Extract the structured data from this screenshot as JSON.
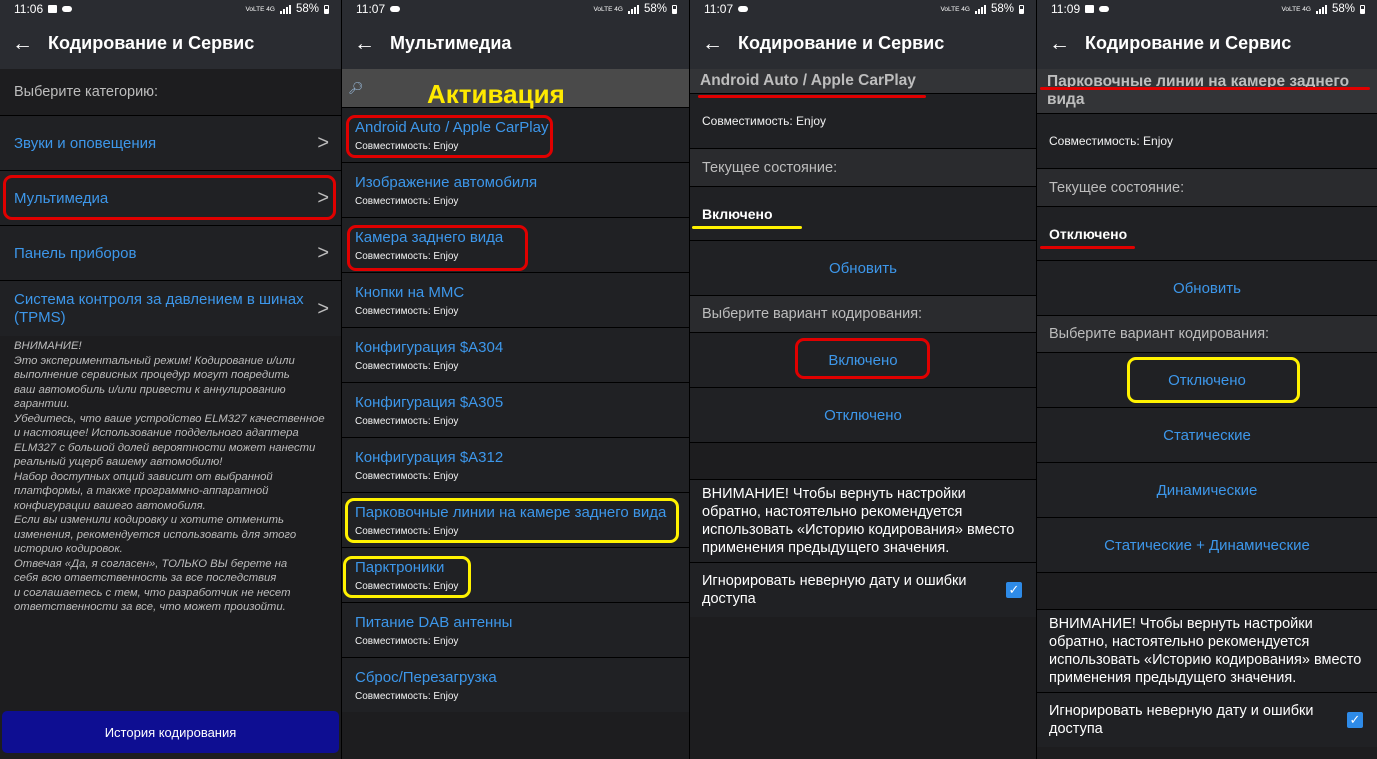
{
  "panel1": {
    "status": {
      "time": "11:06",
      "battery": "58%",
      "net": "VoLTE 4G"
    },
    "title": "Кодирование и Сервис",
    "prompt": "Выберите категорию:",
    "categories": [
      {
        "label": "Звуки и оповещения"
      },
      {
        "label": "Мультимедиа"
      },
      {
        "label": "Панель приборов"
      },
      {
        "label": "Система контроля за давлением в шинах (TPMS)"
      }
    ],
    "arrow": ">",
    "warning": [
      "ВНИМАНИЕ!",
      "Это экспериментальный режим! Кодирование и/или",
      "выполнение сервисных процедур могут повредить",
      "ваш автомобиль и/или привести к аннулированию",
      "гарантии.",
      "Убедитесь, что ваше устройство ELM327 качественное",
      "и настоящее! Использование поддельного адаптера",
      "ELM327 с большой долей вероятности может нанести",
      "реальный ущерб вашему автомобилю!",
      "Набор доступных опций зависит от выбранной",
      "платформы, а также программно-аппаратной",
      "конфигурации вашего автомобиля.",
      "Если вы изменили кодировку и хотите отменить",
      "изменения, рекомендуется использовать для этого",
      "историю кодировок.",
      "Отвечая «Да, я согласен», ТОЛЬКО ВЫ берете на",
      "себя всю ответственность за все последствия",
      "и соглашаетесь с тем, что разработчик не несет",
      "ответственности за все, что может произойти."
    ],
    "history_button": "История кодирования"
  },
  "panel2": {
    "status": {
      "time": "11:07",
      "battery": "58%",
      "net": "VoLTE 4G"
    },
    "title": "Мультимедиа",
    "annotation": "Активация",
    "items": [
      {
        "title": "Android Auto / Apple CarPlay",
        "sub": "Совместимость: Enjoy"
      },
      {
        "title": "Изображение автомобиля",
        "sub": "Совместимость: Enjoy"
      },
      {
        "title": "Камера заднего вида",
        "sub": "Совместимость: Enjoy"
      },
      {
        "title": "Кнопки на ММС",
        "sub": "Совместимость: Enjoy"
      },
      {
        "title": "Конфигурация $A304",
        "sub": "Совместимость: Enjoy"
      },
      {
        "title": "Конфигурация $A305",
        "sub": "Совместимость: Enjoy"
      },
      {
        "title": "Конфигурация $A312",
        "sub": "Совместимость: Enjoy"
      },
      {
        "title": "Парковочные линии на камере заднего вида",
        "sub": "Совместимость: Enjoy"
      },
      {
        "title": "Парктроники",
        "sub": "Совместимость: Enjoy"
      },
      {
        "title": "Питание DAB антенны",
        "sub": "Совместимость: Enjoy"
      },
      {
        "title": "Сброс/Перезагрузка",
        "sub": "Совместимость: Enjoy"
      }
    ]
  },
  "panel3": {
    "status": {
      "time": "11:07",
      "battery": "58%",
      "net": "VoLTE 4G"
    },
    "title": "Кодирование и Сервис",
    "feature": "Android Auto / Apple CarPlay",
    "compat": "Совместимость: Enjoy",
    "current_label": "Текущее состояние:",
    "current_value": "Включено",
    "refresh": "Обновить",
    "choose_label": "Выберите вариант кодирования:",
    "options": [
      "Включено",
      "Отключено"
    ],
    "warning": "ВНИМАНИЕ! Чтобы вернуть настройки обратно, настоятельно рекомендуется использовать «Историю кодирования» вместо применения предыдущего значения.",
    "ignore_label": "Игнорировать неверную дату и ошибки доступа",
    "check": "✓"
  },
  "panel4": {
    "status": {
      "time": "11:09",
      "battery": "58%",
      "net": "VoLTE 4G"
    },
    "title": "Кодирование и Сервис",
    "feature": "Парковочные линии на камере заднего вида",
    "compat": "Совместимость: Enjoy",
    "current_label": "Текущее состояние:",
    "current_value": "Отключено",
    "refresh": "Обновить",
    "choose_label": "Выберите вариант кодирования:",
    "options": [
      "Отключено",
      "Статические",
      "Динамические",
      "Статические + Динамические"
    ],
    "warning": "ВНИМАНИЕ! Чтобы вернуть настройки обратно, настоятельно рекомендуется использовать «Историю кодирования» вместо применения предыдущего значения.",
    "ignore_label": "Игнорировать неверную дату и ошибки доступа",
    "check": "✓"
  },
  "colors": {
    "link": "#3d97ea",
    "highlight_red": "#e00000",
    "highlight_yellow": "#fff200",
    "history_button": "#0e0e92"
  }
}
